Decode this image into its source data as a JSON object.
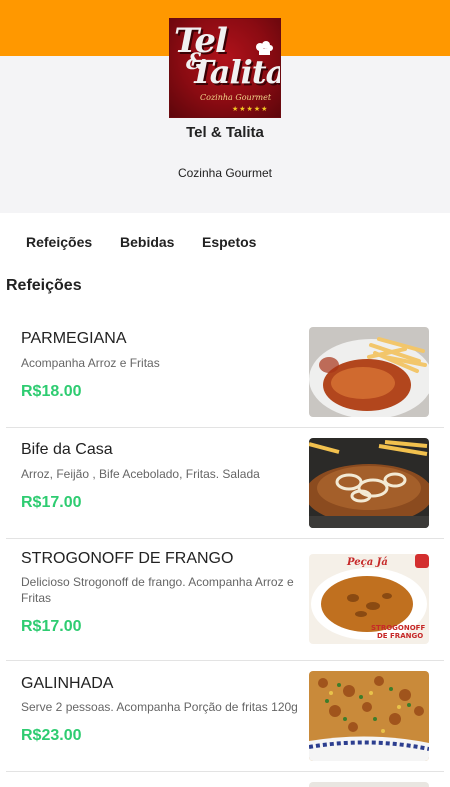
{
  "header": {
    "accent_color": "#ff9800",
    "logo": {
      "line1": "Tel",
      "amp": "&",
      "line2": "Talita",
      "sub": "Cozinha Gourmet",
      "stars": "★★★★★"
    },
    "store_name": "Tel & Talita",
    "tagline": "Cozinha Gourmet"
  },
  "tabs": [
    {
      "label": "Refeições"
    },
    {
      "label": "Bebidas"
    },
    {
      "label": "Espetos"
    }
  ],
  "section": {
    "title": "Refeições"
  },
  "items": [
    {
      "name": "PARMEGIANA",
      "description": "Acompanha Arroz e Fritas",
      "price": "R$18.00",
      "image_icon": "parmegiana-photo"
    },
    {
      "name": "Bife da Casa",
      "description": "Arroz, Feijão , Bife Acebolado, Fritas. Salada",
      "price": "R$17.00",
      "image_icon": "bife-photo"
    },
    {
      "name": "STROGONOFF DE FRANGO",
      "description": "Delicioso Strogonoff de frango. Acompanha Arroz e Fritas",
      "price": "R$17.00",
      "image_icon": "strogonoff-photo",
      "image_text_top": "Peça Já",
      "image_text_bottom1": "STROGONOFF",
      "image_text_bottom2": "DE FRANGO"
    },
    {
      "name": "GALINHADA",
      "description": "Serve 2 pessoas. Acompanha Porção de fritas 120g",
      "price": "R$23.00",
      "image_icon": "galinhada-photo"
    }
  ],
  "colors": {
    "price": "#2ecc71",
    "divider": "#e3e3e3",
    "header_bg": "#f4f4f6"
  }
}
